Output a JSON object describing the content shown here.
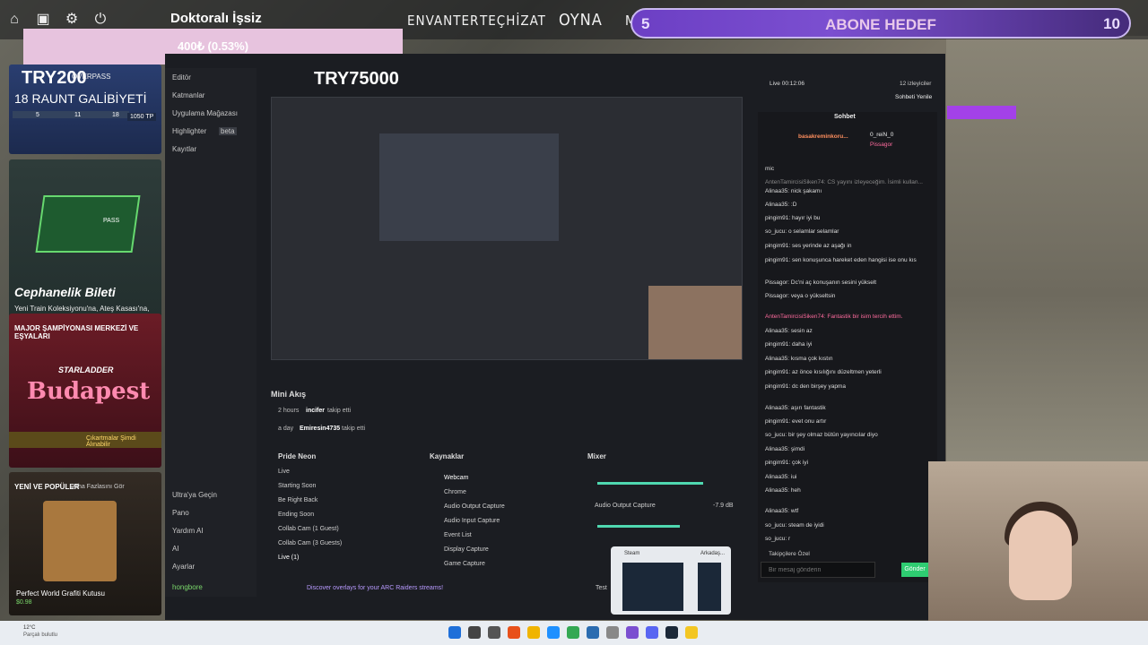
{
  "top": {
    "player_name": "Doktoralı İşsiz",
    "nav": [
      "ENVANTER",
      "TEÇHİZAT",
      "OYNA",
      "M"
    ],
    "goal_pink": "400₺ (0.53%)",
    "sub_goal": {
      "left": "5",
      "title": "ABONE HEDEF",
      "right": "10"
    }
  },
  "store": {
    "card1": {
      "tag": "TRY200",
      "pass": "OVERPASS",
      "rounds": "18 RAUNT GALİBİYETİ",
      "tp": "1050 TP",
      "nums": [
        "5",
        "11",
        "18"
      ]
    },
    "card2": {
      "title": "Cephanelik Bileti",
      "desc": "Yeni Train Koleksiyonu'na, Ateş Kasası'na, süslere ve daha fazlasına erişin.",
      "pass_label": "PASS"
    },
    "card3": {
      "title": "MAJOR ŞAMPİYONASI MERKEZİ VE EŞYALARI",
      "brand": "STARLADDER",
      "city": "Budapest",
      "link": "Çıkartmalar Şimdi Alınabilir"
    },
    "card4": {
      "title": "YENİ VE POPÜLER",
      "sub": "Daha Fazlasını Gör",
      "item": "Perfect World Grafiti Kutusu",
      "price": "$0.98"
    }
  },
  "obs": {
    "try": "TRY75000",
    "side": [
      "Editör",
      "Katmanlar",
      "Uygulama Mağazası",
      "Highlighter",
      "Kayıtlar"
    ],
    "side_beta": "beta",
    "side_bottom": [
      "Ultra'ya Geçin",
      "Pano",
      "Yardım AI",
      "AI",
      "Ayarlar",
      "hongbore"
    ],
    "mini_head": "Mini Akış",
    "feed": [
      {
        "time": "2 hours",
        "user": "incifer",
        "action": "takip etti"
      },
      {
        "time": "a day",
        "user": "Emiresin4735",
        "action": "takip etti"
      }
    ],
    "scenes_head": "Pride Neon",
    "scenes": [
      "Live",
      "Starting Soon",
      "Be Right Back",
      "Ending Soon",
      "Collab Cam (1 Guest)",
      "Collab Cam (3 Guests)",
      "Live (1)"
    ],
    "sources_head": "Kaynaklar",
    "sources": [
      "Webcam",
      "Chrome",
      "Audio Output Capture",
      "Audio Input Capture",
      "Event List",
      "Display Capture",
      "Game Capture"
    ],
    "mixer_head": "Mixer",
    "mixer_item": "Audio Output Capture",
    "mixer_db": "-7.9 dB",
    "banner": "Discover overlays for your ARC Raiders streams!",
    "test": "Test",
    "steam": "Steam",
    "arkadas": "Arkadaş..."
  },
  "chat": {
    "live": "Live 00:12:06",
    "viewers": "12 izleyiciler",
    "refresh": "Sohbeti Yenile",
    "head": "Sohbet",
    "top_user": "basakreminkoru...",
    "top_right": [
      "0_reiN_0",
      "Pissagor"
    ],
    "messages": [
      "mic",
      "AntenTamircisiSiken74: CS yayını izleyeceğim. İsimli kullan...",
      "Alinaa35: nick şakamı",
      "Alinaa35: :D",
      "pingim91: hayır iyi bu",
      "so_jucu: o selamlar selamlar",
      "pingim91: ses yerinde az aşağı in",
      "pingim91: sen konuşunca hareket eden hangisi ise onu kıs",
      "Pissagor: Dc'ni aç konuşanın sesini yükselt",
      "Pissagor: veya o yükseltsin",
      "AntenTamircisiSiken74: Fantastik bir isim tercih ettim.",
      "Alinaa35: sesin az",
      "pingim91: daha iyi",
      "Alinaa35: kısma çok kıstın",
      "pingim91: az önce kısılığını düzeltmen yeterli",
      "pingim91: dc den birşey yapma",
      "Alinaa35: aşırı fantastik",
      "pingim91: evet onu artır",
      "so_jucu: bir şey olmaz bütün yayıncılar diyo",
      "Alinaa35: şimdi",
      "pingim91: çok iyi",
      "Alinaa35: iui",
      "Alinaa35: heh",
      "Alinaa35: wtf",
      "so_jucu: steam de iyidi",
      "so_jucu: r"
    ],
    "followers": "Takipçilere Özel",
    "input_placeholder": "Bir mesaj gönderin",
    "send": "Gönder"
  },
  "taskbar": {
    "weather": "12°C",
    "weather_sub": "Parçalı bulutlu"
  }
}
